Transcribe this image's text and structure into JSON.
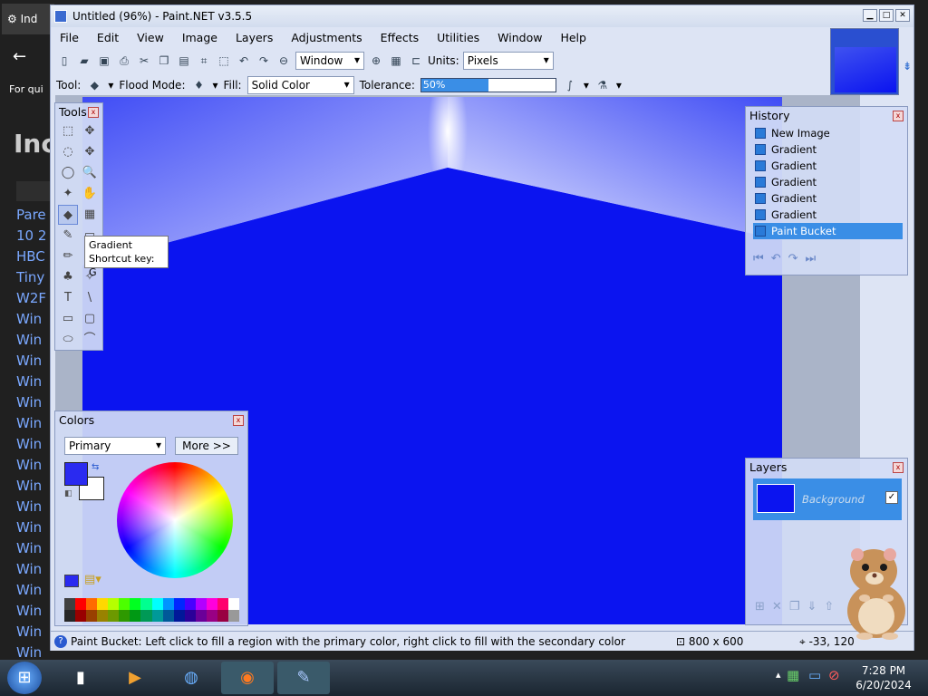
{
  "background_browser": {
    "tab_label": "Ind",
    "back_icon": "back-arrow-icon",
    "hint_text": "For qui",
    "page_title": "Inc",
    "links": [
      "Pare",
      "10 2",
      "HBC",
      "Tiny",
      "W2F",
      "Win",
      "Win",
      "Win",
      "Win",
      "Win",
      "Win",
      "Win",
      "Win",
      "Win",
      "Win",
      "Win",
      "Win",
      "Win",
      "Win",
      "Win",
      "Win",
      "Win",
      "Win"
    ]
  },
  "window": {
    "title": "Untitled (96%) - Paint.NET v3.5.5",
    "buttons": {
      "minimize": "▁",
      "maximize": "□",
      "close": "✕"
    }
  },
  "menu": [
    "File",
    "Edit",
    "View",
    "Image",
    "Layers",
    "Adjustments",
    "Effects",
    "Utilities",
    "Window",
    "Help"
  ],
  "toolbar1": {
    "icons": [
      "new-icon",
      "open-icon",
      "save-icon",
      "print-icon",
      "cut-icon",
      "copy-icon",
      "paste-icon",
      "crop-icon",
      "deselect-icon",
      "undo-icon",
      "redo-icon",
      "zoom-out-icon"
    ],
    "zoom_value": "Window",
    "units_label": "Units:",
    "units_value": "Pixels"
  },
  "toolbar2": {
    "tool_label": "Tool:",
    "flood_mode_label": "Flood Mode:",
    "fill_label": "Fill:",
    "fill_value": "Solid Color",
    "tolerance_label": "Tolerance:",
    "tolerance_value": "50%",
    "tolerance_fraction": 0.5
  },
  "tools_panel": {
    "title": "Tools",
    "close": "x",
    "tools": [
      {
        "name": "rectangle-select-tool",
        "glyph": "⬚"
      },
      {
        "name": "move-selection-tool",
        "glyph": "✥"
      },
      {
        "name": "lasso-select-tool",
        "glyph": "◌"
      },
      {
        "name": "move-selected-tool",
        "glyph": "✥"
      },
      {
        "name": "ellipse-select-tool",
        "glyph": "◯"
      },
      {
        "name": "zoom-tool",
        "glyph": "🔍"
      },
      {
        "name": "magic-wand-tool",
        "glyph": "✦"
      },
      {
        "name": "pan-tool",
        "glyph": "✋"
      },
      {
        "name": "paint-bucket-tool",
        "glyph": "◆",
        "active": true
      },
      {
        "name": "gradient-tool",
        "glyph": "▦"
      },
      {
        "name": "paintbrush-tool",
        "glyph": "✎"
      },
      {
        "name": "eraser-tool",
        "glyph": "▭"
      },
      {
        "name": "pencil-tool",
        "glyph": "✏"
      },
      {
        "name": "color-picker-tool",
        "glyph": "⌂"
      },
      {
        "name": "clone-stamp-tool",
        "glyph": "♣"
      },
      {
        "name": "recolor-tool",
        "glyph": "✧"
      },
      {
        "name": "text-tool",
        "glyph": "T"
      },
      {
        "name": "line-curve-tool",
        "glyph": "\\"
      },
      {
        "name": "rectangle-tool",
        "glyph": "▭"
      },
      {
        "name": "rounded-rectangle-tool",
        "glyph": "▢"
      },
      {
        "name": "ellipse-tool",
        "glyph": "⬭"
      },
      {
        "name": "freeform-shape-tool",
        "glyph": "⌒"
      }
    ]
  },
  "tooltip": {
    "title": "Gradient",
    "shortcut": "Shortcut key: G"
  },
  "history_panel": {
    "title": "History",
    "close": "x",
    "items": [
      {
        "label": "New Image",
        "icon": "new-image-icon"
      },
      {
        "label": "Gradient",
        "icon": "gradient-icon"
      },
      {
        "label": "Gradient",
        "icon": "gradient-icon"
      },
      {
        "label": "Gradient",
        "icon": "gradient-icon"
      },
      {
        "label": "Gradient",
        "icon": "gradient-icon"
      },
      {
        "label": "Gradient",
        "icon": "gradient-icon"
      },
      {
        "label": "Paint Bucket",
        "icon": "paint-bucket-icon",
        "current": true
      }
    ],
    "controls": [
      "rewind-icon",
      "undo-icon",
      "redo-icon",
      "fast-forward-icon"
    ]
  },
  "colors_panel": {
    "title": "Colors",
    "close": "x",
    "mode": "Primary",
    "more_button": "More >>",
    "primary_color": "#2a2af0",
    "secondary_color": "#ffffff",
    "palette": [
      "#404040",
      "#ff0000",
      "#ff6a00",
      "#ffd800",
      "#b6ff00",
      "#4cff00",
      "#00ff21",
      "#00ff90",
      "#00ffff",
      "#0094ff",
      "#0026ff",
      "#4800ff",
      "#b200ff",
      "#ff00dc",
      "#ff006e",
      "#ffffff"
    ]
  },
  "layers_panel": {
    "title": "Layers",
    "close": "x",
    "layer_name": "Background",
    "layer_visible": "✓",
    "controls": [
      "add-layer-icon",
      "delete-layer-icon",
      "duplicate-layer-icon",
      "merge-layer-icon",
      "move-up-icon"
    ]
  },
  "status_bar": {
    "text": "Paint Bucket: Left click to fill a region with the primary color, right click to fill with the secondary color",
    "image_size": "800 x 600",
    "cursor_position": "-33, 120"
  },
  "taskbar": {
    "time": "7:28 PM",
    "date": "6/20/2024"
  },
  "colors": {
    "accent": "#3a8ee6",
    "canvas": "#0b14f0"
  }
}
